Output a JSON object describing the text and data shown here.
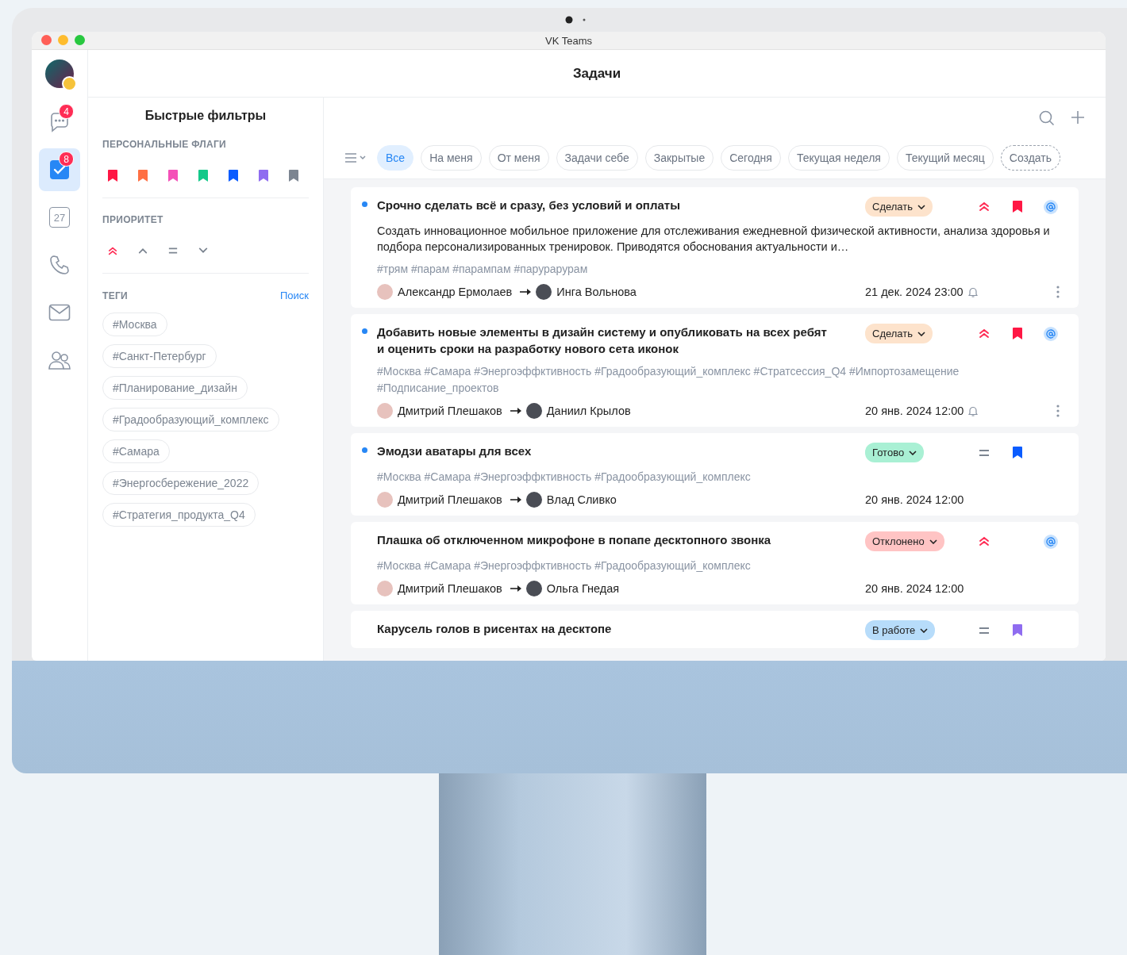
{
  "window": {
    "title": "VK Teams"
  },
  "nav": [
    {
      "kind": "chats",
      "badge": "4",
      "selected": false
    },
    {
      "kind": "tasks",
      "badge": "8",
      "selected": true
    },
    {
      "kind": "calendar",
      "label": "27",
      "selected": false
    },
    {
      "kind": "calls",
      "selected": false
    },
    {
      "kind": "mail",
      "selected": false
    },
    {
      "kind": "contacts",
      "selected": false
    }
  ],
  "header": {
    "title": "Задачи"
  },
  "filters": {
    "title": "Быстрые фильтры",
    "flags_heading": "ПЕРСОНАЛЬНЫЕ ФЛАГИ",
    "flags": [
      {
        "color": "#ff1744"
      },
      {
        "color": "#ff7043"
      },
      {
        "color": "#f450b8"
      },
      {
        "color": "#14c98a"
      },
      {
        "color": "#0a5cff"
      },
      {
        "color": "#8f6cf0"
      },
      {
        "color": "#7c8591"
      }
    ],
    "priority_heading": "ПРИОРИТЕТ",
    "priorities": [
      {
        "kind": "highest"
      },
      {
        "kind": "high"
      },
      {
        "kind": "medium"
      },
      {
        "kind": "low"
      }
    ],
    "tags_heading": "ТЕГИ",
    "tags_search": "Поиск",
    "tags": [
      "#Москва",
      "#Санкт-Петербург",
      "#Планирование_дизайн",
      "#Градообразующий_комплекс",
      "#Самара",
      "#Энергосбережение_2022",
      "#Стратегия_продукта_Q4"
    ]
  },
  "chips": [
    {
      "label": "Все",
      "selected": true
    },
    {
      "label": "На меня",
      "selected": false
    },
    {
      "label": "От меня",
      "selected": false
    },
    {
      "label": "Задачи себе",
      "selected": false
    },
    {
      "label": "Закрытые",
      "selected": false
    },
    {
      "label": "Сегодня",
      "selected": false
    },
    {
      "label": "Текущая неделя",
      "selected": false
    },
    {
      "label": "Текущий месяц",
      "selected": false
    }
  ],
  "create_chip": "Создать",
  "tasks": [
    {
      "unread": true,
      "title": "Срочно сделать всё и сразу, без условий и оплаты",
      "description": "Создать инновационное мобильное приложение для отслеживания ежедневной физической активности, анализа здоровья и подбора персонализированных тренировок. Приводятся обоснования актуальности и…",
      "tags": "#трям #парам #парампам #парурарурам",
      "author": "Александр Ермолаев",
      "assignee": "Инга Вольнова",
      "date": "21 дек. 2024 23:00",
      "reminder": true,
      "status": {
        "label": "Сделать",
        "kind": "todo"
      },
      "priority": {
        "kind": "highest"
      },
      "flag": {
        "color": "#ff1744"
      },
      "mention": true,
      "menu": true
    },
    {
      "unread": true,
      "title": "Добавить новые элементы в дизайн систему и опубликовать на всех ребят и оценить сроки на разработку нового сета иконок",
      "tags": "#Москва #Самара #Энергоэффктивность #Градообразующий_комплекс #Стратсессия_Q4 #Импортозамещение #Подписание_проектов",
      "author": "Дмитрий Плешаков",
      "assignee": "Даниил Крылов",
      "date": "20 янв. 2024 12:00",
      "reminder": true,
      "status": {
        "label": "Сделать",
        "kind": "todo"
      },
      "priority": {
        "kind": "highest"
      },
      "flag": {
        "color": "#ff1744"
      },
      "mention": true,
      "menu": true
    },
    {
      "unread": true,
      "title": "Эмодзи аватары для всех",
      "tags": "#Москва #Самара #Энергоэффктивность #Градообразующий_комплекс",
      "author": "Дмитрий Плешаков",
      "assignee": "Влад Сливко",
      "date": "20 янв. 2024 12:00",
      "reminder": false,
      "status": {
        "label": "Готово",
        "kind": "done"
      },
      "priority": {
        "kind": "medium"
      },
      "flag": {
        "color": "#0a5cff"
      },
      "mention": false,
      "menu": false
    },
    {
      "unread": false,
      "title": "Плашка об отключенном микрофоне в попапе десктопного звонка",
      "tags": "#Москва #Самара #Энергоэффктивность #Градообразующий_комплекс",
      "author": "Дмитрий Плешаков",
      "assignee": "Ольга Гнедая",
      "date": "20 янв. 2024 12:00",
      "reminder": false,
      "status": {
        "label": "Отклонено",
        "kind": "rejected"
      },
      "priority": {
        "kind": "highest"
      },
      "mention": true,
      "menu": false
    },
    {
      "unread": false,
      "title": "Карусель голов в рисентах на десктопе",
      "status": {
        "label": "В работе",
        "kind": "progress"
      },
      "priority": {
        "kind": "medium"
      },
      "flag": {
        "color": "#8f6cf0"
      },
      "mention": false,
      "menu": false
    }
  ]
}
